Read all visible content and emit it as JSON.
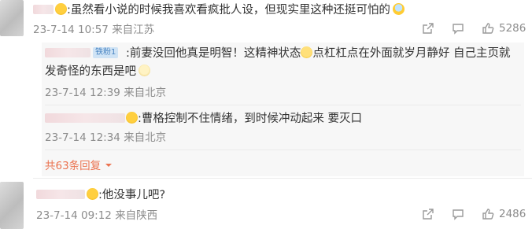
{
  "comments": [
    {
      "text": ":虽然看小说的时候我喜欢看疯批人设，但现实里这种还挺可怕的",
      "time": "23-7-14 10:57",
      "location": "来自江苏",
      "likes": "5286"
    },
    {
      "text": ":他没事儿吧?",
      "time": "23-7-14 09:12",
      "location": "来自陕西",
      "likes": "2486"
    }
  ],
  "replies": [
    {
      "badge": "铁粉1",
      "text_line1": ":前妻没回他真是明智！这精神状态",
      "text_line1b": "点杠杠点在外面就岁月静好 自己主页就",
      "text_line2": "发奇怪的东西是吧",
      "time": "23-7-14 12:39",
      "location": "来自北京"
    },
    {
      "text": ":曹格控制不住情绪，到时候冲动起来 要灭口",
      "time": "23-7-14 12:34",
      "location": "来自北京"
    }
  ],
  "more_replies": "共63条回复",
  "icons": [
    "share-icon",
    "comment-icon",
    "like-icon",
    "emoji-icon",
    "chevron-down-icon"
  ],
  "colors": {
    "accent": "#eb7350",
    "meta": "#8c8c8c",
    "badge": "#4b86c2"
  }
}
